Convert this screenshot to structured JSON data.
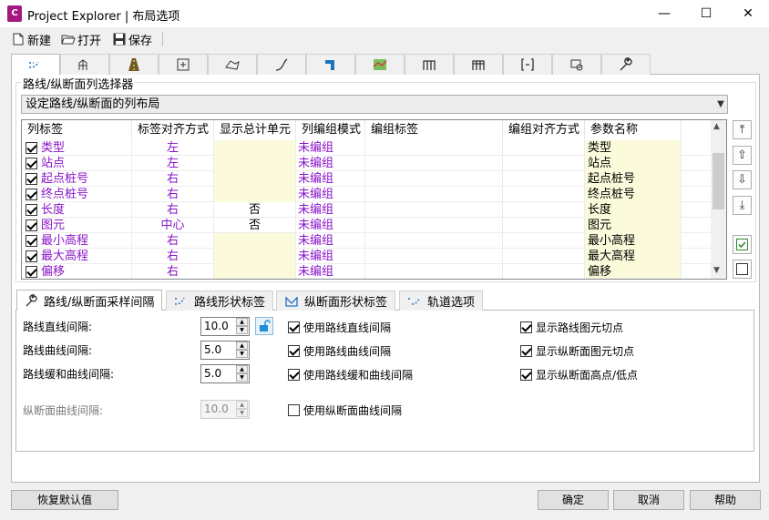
{
  "window": {
    "title": "Project Explorer | 布局选项",
    "app_icon_text": "C",
    "minimize": "—",
    "maximize": "☐",
    "close": "✕"
  },
  "toolbar": {
    "new_label": "新建",
    "open_label": "打开",
    "save_label": "保存"
  },
  "main_tabs": [
    "alignment-tab",
    "profile-tab",
    "corridor-tab",
    "assembly-tab",
    "surface-tab",
    "pipe-tab",
    "structure-tab",
    "parcel-tab",
    "pressure-pipe-tab",
    "fitting-tab",
    "appurtenance-tab",
    "point-tab",
    "settings-tab"
  ],
  "selector": {
    "group_title": "路线/纵断面列选择器",
    "layout_select_value": "设定路线/纵断面的列布局"
  },
  "grid": {
    "headers": [
      "列标签",
      "标签对齐方式",
      "显示总计单元",
      "列编组模式",
      "编组标签",
      "编组对齐方式",
      "参数名称"
    ],
    "rows": [
      {
        "checked": true,
        "label": "类型",
        "align": "左",
        "total": "",
        "group_mode": "未编组",
        "group_label": "",
        "group_align": "",
        "param": "类型"
      },
      {
        "checked": true,
        "label": "站点",
        "align": "左",
        "total": "",
        "group_mode": "未编组",
        "group_label": "",
        "group_align": "",
        "param": "站点"
      },
      {
        "checked": true,
        "label": "起点桩号",
        "align": "右",
        "total": "",
        "group_mode": "未编组",
        "group_label": "",
        "group_align": "",
        "param": "起点桩号"
      },
      {
        "checked": true,
        "label": "终点桩号",
        "align": "右",
        "total": "",
        "group_mode": "未编组",
        "group_label": "",
        "group_align": "",
        "param": "终点桩号"
      },
      {
        "checked": true,
        "label": "长度",
        "align": "右",
        "total": "否",
        "group_mode": "未编组",
        "group_label": "",
        "group_align": "",
        "param": "长度"
      },
      {
        "checked": true,
        "label": "图元",
        "align": "中心",
        "total": "否",
        "group_mode": "未编组",
        "group_label": "",
        "group_align": "",
        "param": "图元"
      },
      {
        "checked": true,
        "label": "最小高程",
        "align": "右",
        "total": "",
        "group_mode": "未编组",
        "group_label": "",
        "group_align": "",
        "param": "最小高程"
      },
      {
        "checked": true,
        "label": "最大高程",
        "align": "右",
        "total": "",
        "group_mode": "未编组",
        "group_label": "",
        "group_align": "",
        "param": "最大高程"
      },
      {
        "checked": true,
        "label": "偏移",
        "align": "右",
        "total": "",
        "group_mode": "未编组",
        "group_label": "",
        "group_align": "",
        "param": "偏移"
      }
    ]
  },
  "sub_tabs": [
    "路线/纵断面采样间隔",
    "路线形状标签",
    "纵断面形状标签",
    "轨道选项"
  ],
  "sampling": {
    "fields": [
      {
        "label": "路线直线间隔:",
        "value": "10.0",
        "enabled": true
      },
      {
        "label": "路线曲线间隔:",
        "value": "5.0",
        "enabled": true
      },
      {
        "label": "路线缓和曲线间隔:",
        "value": "5.0",
        "enabled": true
      },
      {
        "label": "纵断面曲线间隔:",
        "value": "10.0",
        "enabled": false
      }
    ],
    "use_checks": [
      {
        "label": "使用路线直线间隔",
        "checked": true
      },
      {
        "label": "使用路线曲线间隔",
        "checked": true
      },
      {
        "label": "使用路线缓和曲线间隔",
        "checked": true
      },
      {
        "label": "使用纵断面曲线间隔",
        "checked": false
      }
    ],
    "show_checks": [
      {
        "label": "显示路线图元切点",
        "checked": true
      },
      {
        "label": "显示纵断面图元切点",
        "checked": true
      },
      {
        "label": "显示纵断面高点/低点",
        "checked": true
      }
    ]
  },
  "buttons": {
    "restore_defaults": "恢复默认值",
    "ok": "确定",
    "cancel": "取消",
    "help": "帮助"
  }
}
